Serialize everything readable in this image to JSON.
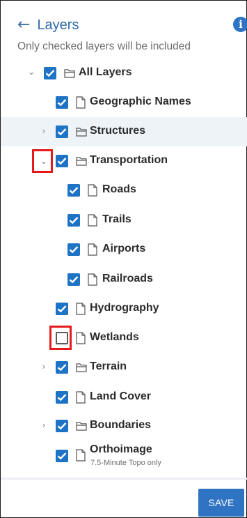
{
  "header": {
    "back_arrow": "←",
    "title": "Layers",
    "info_glyph": "i",
    "hint": "Only checked layers will be included"
  },
  "layers": {
    "all_layers": "All Layers",
    "geographic_names": "Geographic Names",
    "structures": "Structures",
    "transportation": "Transportation",
    "roads": "Roads",
    "trails": "Trails",
    "airports": "Airports",
    "railroads": "Railroads",
    "hydrography": "Hydrography",
    "wetlands": "Wetlands",
    "terrain": "Terrain",
    "land_cover": "Land Cover",
    "boundaries": "Boundaries",
    "orthoimage": "Orthoimage",
    "orthoimage_note": "7.5-Minute Topo only"
  },
  "checked": {
    "all_layers": true,
    "geographic_names": true,
    "structures": true,
    "transportation": true,
    "roads": true,
    "trails": true,
    "airports": true,
    "railroads": true,
    "hydrography": true,
    "wetlands": false,
    "terrain": true,
    "land_cover": true,
    "boundaries": true,
    "orthoimage": true
  },
  "icons": {
    "folder": "folder-icon",
    "file": "file-icon",
    "expanded": "chevron-down-icon",
    "collapsed": "chevron-right-icon"
  },
  "chevrons": {
    "down": "⌄",
    "right": "›"
  },
  "footer": {
    "save_label": "SAVE"
  },
  "colors": {
    "accent": "#2f73c3",
    "checkbox": "#1e73c5",
    "highlight_row": "#eef3f8",
    "annotation_box": "#e51a1a",
    "title": "#2f6aa9"
  }
}
